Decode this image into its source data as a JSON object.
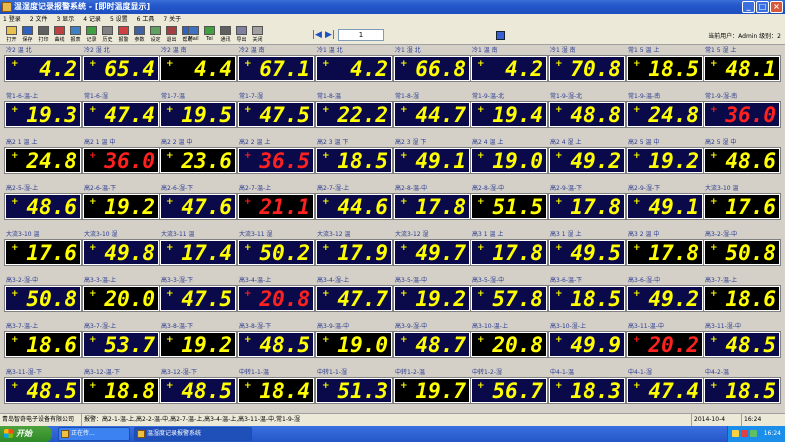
{
  "window": {
    "title": "温湿度记录报警系统 - [即时温度显示]",
    "icon": "app-icon"
  },
  "menu": [
    "1 登录",
    "2 文件",
    "3 显示",
    "4 记录",
    "5 设置",
    "6 工具",
    "7 关于"
  ],
  "toolbar": {
    "tools": [
      "打开",
      "保存",
      "打印",
      "曲线",
      "报表",
      "记录",
      "历史",
      "报警",
      "参数",
      "设定",
      "退出",
      "帮助",
      "Mail",
      "Tel",
      "通讯",
      "导出",
      "关闭"
    ],
    "page": "1",
    "user_info": "当前用户：Admin 级别：2"
  },
  "colors": {
    "yellow": "#ffff00",
    "red": "#ff2020",
    "label": "#2a3a90"
  },
  "tiles": [
    {
      "label": "冷2 温 北",
      "sign": "+",
      "value": "4.2",
      "bg": "navy",
      "alarm": false
    },
    {
      "label": "冷2 湿 北",
      "sign": "+",
      "value": "65.4",
      "bg": "navy",
      "alarm": false
    },
    {
      "label": "冷2 温 南",
      "sign": "+",
      "value": "4.4",
      "bg": "black",
      "alarm": false
    },
    {
      "label": "冷2 温 南",
      "sign": "+",
      "value": "67.1",
      "bg": "navy",
      "alarm": false
    },
    {
      "label": "冷1 温 北",
      "sign": "+",
      "value": "4.2",
      "bg": "navy",
      "alarm": false
    },
    {
      "label": "冷1 湿 北",
      "sign": "+",
      "value": "66.8",
      "bg": "navy",
      "alarm": false
    },
    {
      "label": "冷1 温 南",
      "sign": "+",
      "value": "4.2",
      "bg": "navy",
      "alarm": false
    },
    {
      "label": "冷1 湿 南",
      "sign": "+",
      "value": "70.8",
      "bg": "navy",
      "alarm": false
    },
    {
      "label": "常1 5 温 上",
      "sign": "+",
      "value": "18.5",
      "bg": "black",
      "alarm": false
    },
    {
      "label": "常1 5 湿 上",
      "sign": "+",
      "value": "48.1",
      "bg": "black",
      "alarm": false
    },
    {
      "label": "常1-6-温-上",
      "sign": "+",
      "value": "19.3",
      "bg": "navy",
      "alarm": false
    },
    {
      "label": "常1-6-湿",
      "sign": "+",
      "value": "47.4",
      "bg": "navy",
      "alarm": false
    },
    {
      "label": "常1-7-温",
      "sign": "+",
      "value": "19.5",
      "bg": "navy",
      "alarm": false
    },
    {
      "label": "常1-7-湿",
      "sign": "+",
      "value": "47.5",
      "bg": "navy",
      "alarm": false
    },
    {
      "label": "常1-8-温",
      "sign": "+",
      "value": "22.2",
      "bg": "navy",
      "alarm": false
    },
    {
      "label": "常1-8-湿",
      "sign": "+",
      "value": "44.7",
      "bg": "navy",
      "alarm": false
    },
    {
      "label": "常1-9-温-北",
      "sign": "+",
      "value": "19.4",
      "bg": "navy",
      "alarm": false
    },
    {
      "label": "常1-9-湿-北",
      "sign": "+",
      "value": "48.8",
      "bg": "navy",
      "alarm": false
    },
    {
      "label": "常1-9-温-南",
      "sign": "+",
      "value": "24.8",
      "bg": "navy",
      "alarm": false
    },
    {
      "label": "常1-9-湿-南",
      "sign": "+",
      "value": "36.0",
      "bg": "navy",
      "alarm": true
    },
    {
      "label": "高2 1 温 上",
      "sign": "+",
      "value": "24.8",
      "bg": "black",
      "alarm": false
    },
    {
      "label": "高2 1 温 中",
      "sign": "+",
      "value": "36.0",
      "bg": "black",
      "alarm": true
    },
    {
      "label": "高2 2 温 中",
      "sign": "+",
      "value": "23.6",
      "bg": "black",
      "alarm": false
    },
    {
      "label": "高2 2 温 上",
      "sign": "+",
      "value": "36.5",
      "bg": "navy",
      "alarm": true
    },
    {
      "label": "高2 3 温 下",
      "sign": "+",
      "value": "18.5",
      "bg": "navy",
      "alarm": false
    },
    {
      "label": "高2 3 湿 下",
      "sign": "+",
      "value": "49.1",
      "bg": "navy",
      "alarm": false
    },
    {
      "label": "高2 4 温 上",
      "sign": "+",
      "value": "19.0",
      "bg": "navy",
      "alarm": false
    },
    {
      "label": "高2 4 湿 上",
      "sign": "+",
      "value": "49.2",
      "bg": "navy",
      "alarm": false
    },
    {
      "label": "高2 5 温 中",
      "sign": "+",
      "value": "19.2",
      "bg": "navy",
      "alarm": false
    },
    {
      "label": "高2 5 湿 中",
      "sign": "+",
      "value": "48.6",
      "bg": "black",
      "alarm": false
    },
    {
      "label": "高2-5-湿-上",
      "sign": "+",
      "value": "48.6",
      "bg": "navy",
      "alarm": false
    },
    {
      "label": "高2-6-温-下",
      "sign": "+",
      "value": "19.2",
      "bg": "black",
      "alarm": false
    },
    {
      "label": "高2-6-湿-下",
      "sign": "+",
      "value": "47.6",
      "bg": "navy",
      "alarm": false
    },
    {
      "label": "高2-7-温-上",
      "sign": "+",
      "value": "21.1",
      "bg": "black",
      "alarm": true
    },
    {
      "label": "高2-7-湿-上",
      "sign": "+",
      "value": "44.6",
      "bg": "navy",
      "alarm": false
    },
    {
      "label": "高2-8-温-中",
      "sign": "+",
      "value": "17.8",
      "bg": "navy",
      "alarm": false
    },
    {
      "label": "高2-8-湿-中",
      "sign": "+",
      "value": "51.5",
      "bg": "black",
      "alarm": false
    },
    {
      "label": "高2-9-温-下",
      "sign": "+",
      "value": "17.8",
      "bg": "navy",
      "alarm": false
    },
    {
      "label": "高2-9-湿-下",
      "sign": "+",
      "value": "49.1",
      "bg": "navy",
      "alarm": false
    },
    {
      "label": "大流3-10 温",
      "sign": "+",
      "value": "17.6",
      "bg": "black",
      "alarm": false
    },
    {
      "label": "大流3-10 温",
      "sign": "+",
      "value": "17.6",
      "bg": "black",
      "alarm": false
    },
    {
      "label": "大流3-10 湿",
      "sign": "+",
      "value": "49.8",
      "bg": "navy",
      "alarm": false
    },
    {
      "label": "大流3-11 温",
      "sign": "+",
      "value": "17.4",
      "bg": "navy",
      "alarm": false
    },
    {
      "label": "大流3-11 湿",
      "sign": "+",
      "value": "50.2",
      "bg": "navy",
      "alarm": false
    },
    {
      "label": "大流3-12 温",
      "sign": "+",
      "value": "17.9",
      "bg": "navy",
      "alarm": false
    },
    {
      "label": "大流3-12 湿",
      "sign": "+",
      "value": "49.7",
      "bg": "navy",
      "alarm": false
    },
    {
      "label": "高3 1 温 上",
      "sign": "+",
      "value": "17.8",
      "bg": "navy",
      "alarm": false
    },
    {
      "label": "高3 1 湿 上",
      "sign": "+",
      "value": "49.5",
      "bg": "navy",
      "alarm": false
    },
    {
      "label": "高3 2 温 中",
      "sign": "+",
      "value": "17.8",
      "bg": "black",
      "alarm": false
    },
    {
      "label": "高3-2-湿-中",
      "sign": "+",
      "value": "50.8",
      "bg": "black",
      "alarm": false
    },
    {
      "label": "高3-2-湿-中",
      "sign": "+",
      "value": "50.8",
      "bg": "navy",
      "alarm": false
    },
    {
      "label": "高3-3-温-上",
      "sign": "+",
      "value": "20.0",
      "bg": "black",
      "alarm": false
    },
    {
      "label": "高3-3-湿-下",
      "sign": "+",
      "value": "47.5",
      "bg": "navy",
      "alarm": false
    },
    {
      "label": "高3-4-温-上",
      "sign": "+",
      "value": "20.8",
      "bg": "navy",
      "alarm": true
    },
    {
      "label": "高3-4-湿-上",
      "sign": "+",
      "value": "47.7",
      "bg": "navy",
      "alarm": false
    },
    {
      "label": "高3-5-温-中",
      "sign": "+",
      "value": "19.2",
      "bg": "navy",
      "alarm": false
    },
    {
      "label": "高3-5-湿-中",
      "sign": "+",
      "value": "57.8",
      "bg": "navy",
      "alarm": false
    },
    {
      "label": "高3-6-温-下",
      "sign": "+",
      "value": "18.5",
      "bg": "navy",
      "alarm": false
    },
    {
      "label": "高3-6-湿-中",
      "sign": "+",
      "value": "49.2",
      "bg": "navy",
      "alarm": false
    },
    {
      "label": "高3-7-温-上",
      "sign": "+",
      "value": "18.6",
      "bg": "black",
      "alarm": false
    },
    {
      "label": "高3-7-温-上",
      "sign": "+",
      "value": "18.6",
      "bg": "black",
      "alarm": false
    },
    {
      "label": "高3-7-湿-上",
      "sign": "+",
      "value": "53.7",
      "bg": "navy",
      "alarm": false
    },
    {
      "label": "高3-8-温-下",
      "sign": "+",
      "value": "19.2",
      "bg": "black",
      "alarm": false
    },
    {
      "label": "高3-8-湿-下",
      "sign": "+",
      "value": "48.5",
      "bg": "navy",
      "alarm": false
    },
    {
      "label": "高3-9-温-中",
      "sign": "+",
      "value": "19.0",
      "bg": "black",
      "alarm": false
    },
    {
      "label": "高3-9-湿-中",
      "sign": "+",
      "value": "48.7",
      "bg": "navy",
      "alarm": false
    },
    {
      "label": "高3-10-温-上",
      "sign": "+",
      "value": "20.8",
      "bg": "black",
      "alarm": false
    },
    {
      "label": "高3-10-湿-上",
      "sign": "+",
      "value": "49.9",
      "bg": "navy",
      "alarm": false
    },
    {
      "label": "高3-11-温-中",
      "sign": "+",
      "value": "20.2",
      "bg": "black",
      "alarm": true
    },
    {
      "label": "高3-11-湿-中",
      "sign": "+",
      "value": "48.5",
      "bg": "navy",
      "alarm": false
    },
    {
      "label": "高3-11-湿-下",
      "sign": "+",
      "value": "48.5",
      "bg": "navy",
      "alarm": false
    },
    {
      "label": "高3-12-温-下",
      "sign": "+",
      "value": "18.8",
      "bg": "black",
      "alarm": false
    },
    {
      "label": "高3-12-湿-下",
      "sign": "+",
      "value": "48.5",
      "bg": "navy",
      "alarm": false
    },
    {
      "label": "中转1-1-温",
      "sign": "+",
      "value": "18.4",
      "bg": "black",
      "alarm": false
    },
    {
      "label": "中转1-1-湿",
      "sign": "+",
      "value": "51.3",
      "bg": "navy",
      "alarm": false
    },
    {
      "label": "中转1-2-温",
      "sign": "+",
      "value": "19.7",
      "bg": "black",
      "alarm": false
    },
    {
      "label": "中转1-2-湿",
      "sign": "+",
      "value": "56.7",
      "bg": "navy",
      "alarm": false
    },
    {
      "label": "中4-1-温",
      "sign": "+",
      "value": "18.3",
      "bg": "navy",
      "alarm": false
    },
    {
      "label": "中4-1-湿",
      "sign": "+",
      "value": "47.4",
      "bg": "navy",
      "alarm": false
    },
    {
      "label": "中4-2-温",
      "sign": "+",
      "value": "18.5",
      "bg": "navy",
      "alarm": false
    }
  ],
  "statusbar": {
    "company": "青岛智奇电子设备有限公司",
    "alarm_text": "报警：高2-1-温-上,高2-2-温-中,高2-7-温-上,高3-4-温-上,高3-11-温-中,常1-9-湿",
    "date": "2014-10-4",
    "time": "16:24"
  },
  "taskbar": {
    "start": "开始",
    "tasks": [
      "正在传...",
      "温湿度记录报警系统"
    ],
    "clock": "16:24"
  }
}
